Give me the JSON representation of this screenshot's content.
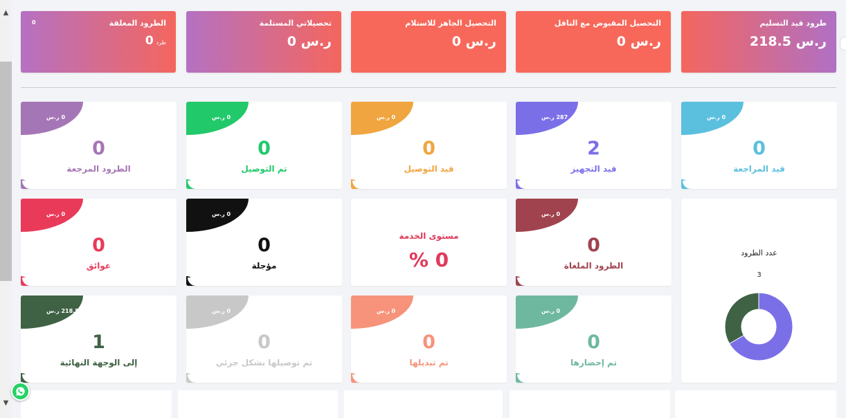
{
  "top_cards": [
    {
      "title": "طرود قيد التسليم",
      "value": "218.5",
      "currency": "ر.س",
      "style": "tc-red-purple"
    },
    {
      "title": "التحصيل المقبوض مع الناقل",
      "value": "0",
      "currency": "ر.س",
      "style": "tc-red"
    },
    {
      "title": "التحصيل الجاهز للاستلام",
      "value": "0",
      "currency": "ر.س",
      "style": "tc-red"
    },
    {
      "title": "تحصيلاتي المستلمة",
      "value": "0",
      "currency": "ر.س",
      "style": "tc-pink-purple"
    },
    {
      "title": "الطرود المغلقة",
      "value": "0",
      "unit": "طرد",
      "corner": "0",
      "style": "tc-pink-purple"
    }
  ],
  "status_cards": [
    {
      "label": "قيد المراجعة",
      "count": "0",
      "sum": "0",
      "color": "#5bc0de"
    },
    {
      "label": "قيد التجهيز",
      "count": "2",
      "sum": "287",
      "color": "#7b6fe8"
    },
    {
      "label": "قيد التوصيل",
      "count": "0",
      "sum": "0",
      "color": "#f0a540"
    },
    {
      "label": "تم التوصيل",
      "count": "0",
      "sum": "0",
      "color": "#22c96b"
    },
    {
      "label": "الطرود المرجعة",
      "count": "0",
      "sum": "0",
      "color": "#a576b5"
    },
    {
      "label": "الطرود الملغاة",
      "count": "0",
      "sum": "0",
      "color": "#a0434e"
    },
    {
      "label": "مؤجلة",
      "count": "0",
      "sum": "0",
      "color": "#111111"
    },
    {
      "label": "عوائق",
      "count": "0",
      "sum": "0",
      "color": "#e93a5a"
    },
    {
      "label": "تم إحضارها",
      "count": "0",
      "sum": "0",
      "color": "#6fb8a0"
    },
    {
      "label": "تم تبديلها",
      "count": "0",
      "sum": "0",
      "color": "#f6937a"
    },
    {
      "label": "تم توصيلها بشكل جزئي",
      "count": "0",
      "sum": "0",
      "color": "#c8c8c8"
    },
    {
      "label": "إلى الوجهة النهائية",
      "count": "1",
      "sum": "218.5",
      "color": "#3f6244"
    }
  ],
  "service_level": {
    "title": "مستوى الخدمة",
    "value": "0 %"
  },
  "pie_chart": {
    "title": "عدد الطرود",
    "total": "3"
  },
  "chart_data": {
    "type": "pie",
    "title": "عدد الطرود",
    "categories": [
      "قيد التجهيز",
      "إلى الوجهة النهائية"
    ],
    "values": [
      2,
      1
    ],
    "colors": [
      "#7b6fe8",
      "#3f6244"
    ],
    "donut": true
  },
  "currency_symbol": "ر.س"
}
